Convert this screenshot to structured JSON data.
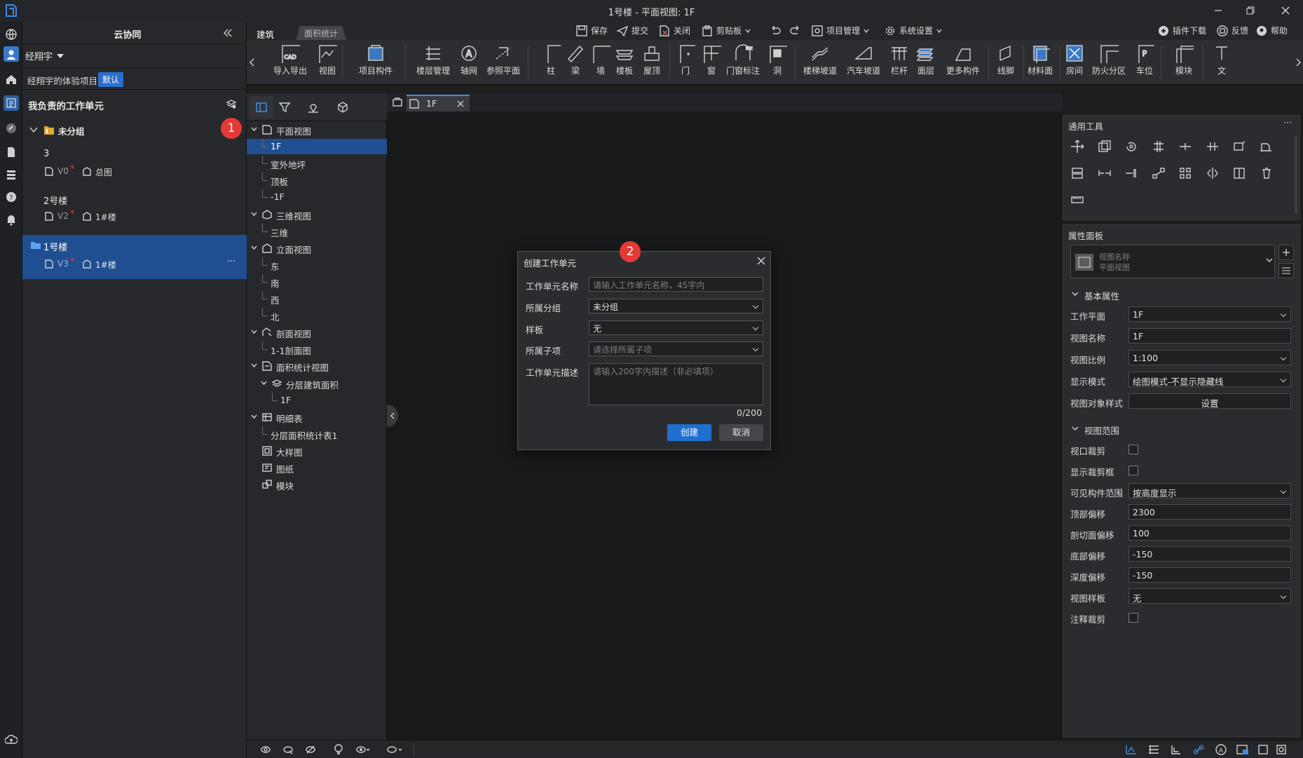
{
  "window": {
    "title": "1号楼 - 平面视图: 1F"
  },
  "colors": {
    "accent": "#1f6fd0",
    "badge": "#e53935",
    "bg": "#1e1e1e"
  },
  "side": {
    "header": "云协同",
    "user": "经翔宇",
    "project": "经翔宇的体验项目",
    "project_tag": "默认",
    "section_title": "我负责的工作单元",
    "group_label": "未分组",
    "units": [
      {
        "name": "3",
        "version": "V0",
        "mark": "*",
        "floor": "总图"
      },
      {
        "name": "2号楼",
        "version": "V2",
        "mark": "*",
        "floor": "1#楼"
      },
      {
        "name": "1号楼",
        "version": "V3",
        "mark": "*",
        "floor": "1#楼",
        "more": "···"
      }
    ]
  },
  "tabs": {
    "architecture": "建筑",
    "area_stats": "面积统计"
  },
  "quick": {
    "save": "保存",
    "submit": "提交",
    "close": "关闭",
    "clipboard": "剪贴板",
    "project_mgmt": "项目管理",
    "system_settings": "系统设置",
    "plugin_download": "插件下载",
    "feedback": "反馈",
    "help": "帮助"
  },
  "ribbon": [
    "导入导出",
    "视图",
    "项目构件",
    "楼层管理",
    "轴网",
    "参照平面",
    "柱",
    "梁",
    "墙",
    "楼板",
    "屋顶",
    "门",
    "窗",
    "门窗标注",
    "洞",
    "楼梯坡道",
    "汽车坡道",
    "栏杆",
    "面层",
    "更多构件",
    "线脚",
    "材料面",
    "房间",
    "防火分区",
    "车位",
    "模块",
    "文"
  ],
  "tree": [
    {
      "label": "平面视图",
      "level": 0,
      "icon": "plan"
    },
    {
      "label": "1F",
      "level": 1,
      "selected": true
    },
    {
      "label": "室外地坪",
      "level": 1
    },
    {
      "label": "顶板",
      "level": 1
    },
    {
      "label": "-1F",
      "level": 1
    },
    {
      "label": "三维视图",
      "level": 0,
      "icon": "3d"
    },
    {
      "label": "三维",
      "level": 1
    },
    {
      "label": "立面视图",
      "level": 0,
      "icon": "elev"
    },
    {
      "label": "东",
      "level": 1
    },
    {
      "label": "南",
      "level": 1
    },
    {
      "label": "西",
      "level": 1
    },
    {
      "label": "北",
      "level": 1
    },
    {
      "label": "剖面视图",
      "level": 0,
      "icon": "section"
    },
    {
      "label": "1-1剖面图",
      "level": 1
    },
    {
      "label": "面积统计视图",
      "level": 0,
      "icon": "area"
    },
    {
      "label": "分层建筑面积",
      "level": 1,
      "icon": "layer"
    },
    {
      "label": "1F",
      "level": 2
    },
    {
      "label": "明细表",
      "level": 0,
      "icon": "table"
    },
    {
      "label": "分层面积统计表1",
      "level": 1
    },
    {
      "label": "大样图",
      "level": 0,
      "icon": "detail",
      "nochev": true
    },
    {
      "label": "图纸",
      "level": 0,
      "icon": "sheet",
      "nochev": true
    },
    {
      "label": "模块",
      "level": 0,
      "icon": "module",
      "nochev": true
    }
  ],
  "doctab": {
    "label": "1F"
  },
  "tools_panel": {
    "title": "通用工具",
    "more": "···"
  },
  "props": {
    "title": "属性面板",
    "type_name": "视图名称",
    "type_sub": "平面视图",
    "basic": "基本属性",
    "work_plane_label": "工作平面",
    "work_plane": "1F",
    "view_name_label": "视图名称",
    "view_name": "1F",
    "scale_label": "视图比例",
    "scale": "1:100",
    "display_mode_label": "显示模式",
    "display_mode": "绘图模式-不显示隐藏线",
    "obj_style_label": "视图对象样式",
    "obj_style_btn": "设置",
    "range": "视图范围",
    "crop_label": "视口裁剪",
    "show_crop_label": "显示裁剪框",
    "visible_range_label": "可见构件范围",
    "visible_range": "按高度显示",
    "top_offset_label": "顶部偏移",
    "top_offset": "2300",
    "cut_offset_label": "剖切面偏移",
    "cut_offset": "100",
    "bottom_offset_label": "底部偏移",
    "bottom_offset": "-150",
    "depth_offset_label": "深度偏移",
    "depth_offset": "-150",
    "view_template_label": "视图样板",
    "view_template": "无",
    "annot_crop_label": "注释裁剪"
  },
  "dialog": {
    "title": "创建工作单元",
    "name_label": "工作单元名称",
    "name_placeholder": "请输入工作单元名称，45字内",
    "group_label": "所属分组",
    "group_value": "未分组",
    "template_label": "样板",
    "template_value": "无",
    "child_label": "所属子项",
    "child_placeholder": "请选择所属子项",
    "desc_label": "工作单元描述",
    "desc_placeholder": "请输入200字内描述（非必填项）",
    "counter": "0/200",
    "create": "创建",
    "cancel": "取消"
  },
  "badges": {
    "one": "1",
    "two": "2"
  }
}
